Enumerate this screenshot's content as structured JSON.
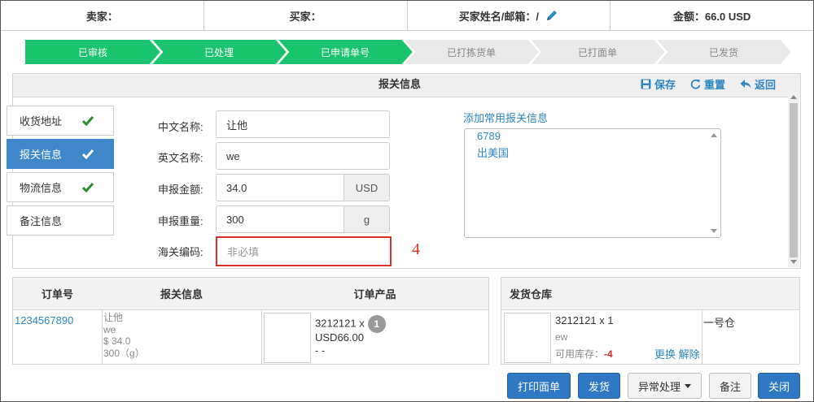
{
  "header": {
    "seller_label": "卖家：",
    "buyer_label": "买家：",
    "buyer_name_email_label": "买家姓名/邮箱：/",
    "amount_label": "金额：66.0 USD"
  },
  "steps": [
    {
      "label": "已审核",
      "done": true
    },
    {
      "label": "已处理",
      "done": true
    },
    {
      "label": "已申请单号",
      "done": true
    },
    {
      "label": "已打拣货单",
      "done": false
    },
    {
      "label": "已打面单",
      "done": false
    },
    {
      "label": "已发货",
      "done": false
    }
  ],
  "customs_panel": {
    "title": "报关信息",
    "save_label": "保存",
    "reset_label": "重置",
    "back_label": "返回"
  },
  "nav": {
    "items": [
      {
        "label": "收货地址",
        "checked": true
      },
      {
        "label": "报关信息",
        "checked": true
      },
      {
        "label": "物流信息",
        "checked": true
      },
      {
        "label": "备注信息",
        "checked": false
      }
    ]
  },
  "form": {
    "cn_name_label": "中文名称:",
    "cn_name_value": "让他",
    "en_name_label": "英文名称:",
    "en_name_value": "we",
    "declared_amount_label": "申报金额:",
    "declared_amount_value": "34.0",
    "declared_amount_unit": "USD",
    "declared_weight_label": "申报重量:",
    "declared_weight_value": "300",
    "declared_weight_unit": "g",
    "hs_code_label": "海关编码:",
    "hs_code_placeholder": "非必填",
    "annotation_marker": "4"
  },
  "templates": {
    "add_link": "添加常用报关信息",
    "lines": [
      "6789",
      "出美国"
    ]
  },
  "orders_table": {
    "headers": [
      "订单号",
      "报关信息",
      "订单产品"
    ],
    "row": {
      "order_no": "1234567890",
      "customs_lines": [
        "让他",
        "we",
        "$ 34.0",
        "300（g）"
      ],
      "product_sku": "3212121 x",
      "product_qty": "1",
      "product_price": "USD66.00",
      "product_extra": "- -"
    }
  },
  "warehouse_table": {
    "header": "发货仓库",
    "sku_line": "3212121 x 1",
    "sub_line": "ew",
    "stock_label": "可用库存：",
    "stock_value": "-4",
    "change_link": "更换",
    "unbind_link": "解除",
    "warehouse_name": "一号仓"
  },
  "footer": {
    "print_label": "打印面单",
    "ship_label": "发货",
    "exception_label": "异常处理",
    "note_label": "备注",
    "close_label": "关闭"
  },
  "colors": {
    "step_done": "#19c46c",
    "step_todo": "#e9e9e9",
    "primary": "#2f78c4",
    "link": "#2d86c6",
    "error": "#d9302b"
  }
}
